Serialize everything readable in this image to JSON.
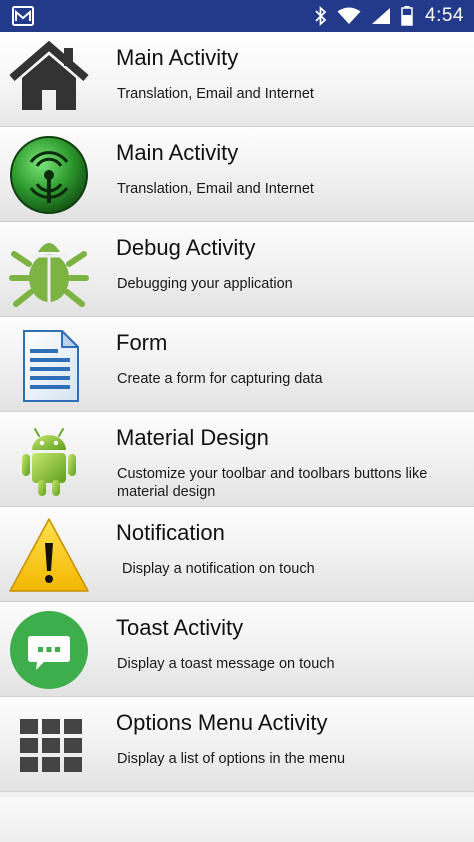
{
  "status_bar": {
    "time": "4:54",
    "icons": [
      "mail-icon",
      "bluetooth-icon",
      "wifi-icon",
      "signal-icon",
      "battery-icon"
    ]
  },
  "items": [
    {
      "title": "Main Activity",
      "subtitle": "Translation, Email and Internet",
      "icon": "home-icon"
    },
    {
      "title": "Main Activity",
      "subtitle": "Translation, Email and Internet",
      "icon": "wireless-signal-icon"
    },
    {
      "title": "Debug Activity",
      "subtitle": "Debugging your application",
      "icon": "bug-icon"
    },
    {
      "title": "Form",
      "subtitle": "Create a form for capturing data",
      "icon": "document-icon"
    },
    {
      "title": "Material Design",
      "subtitle": "Customize your toolbar and toolbars buttons like material design",
      "icon": "android-icon"
    },
    {
      "title": "Notification",
      "subtitle": "Display a notification on touch",
      "icon": "warning-icon"
    },
    {
      "title": "Toast Activity",
      "subtitle": "Display a toast message on touch",
      "icon": "chat-bubble-icon"
    },
    {
      "title": "Options Menu Activity",
      "subtitle": "Display a list of options in the menu",
      "icon": "grid-icon"
    }
  ],
  "colors": {
    "status_bar": "#233a8b",
    "green": "#7cb342",
    "warning_yellow": "#f7c600",
    "toast_green": "#3dae4b"
  }
}
